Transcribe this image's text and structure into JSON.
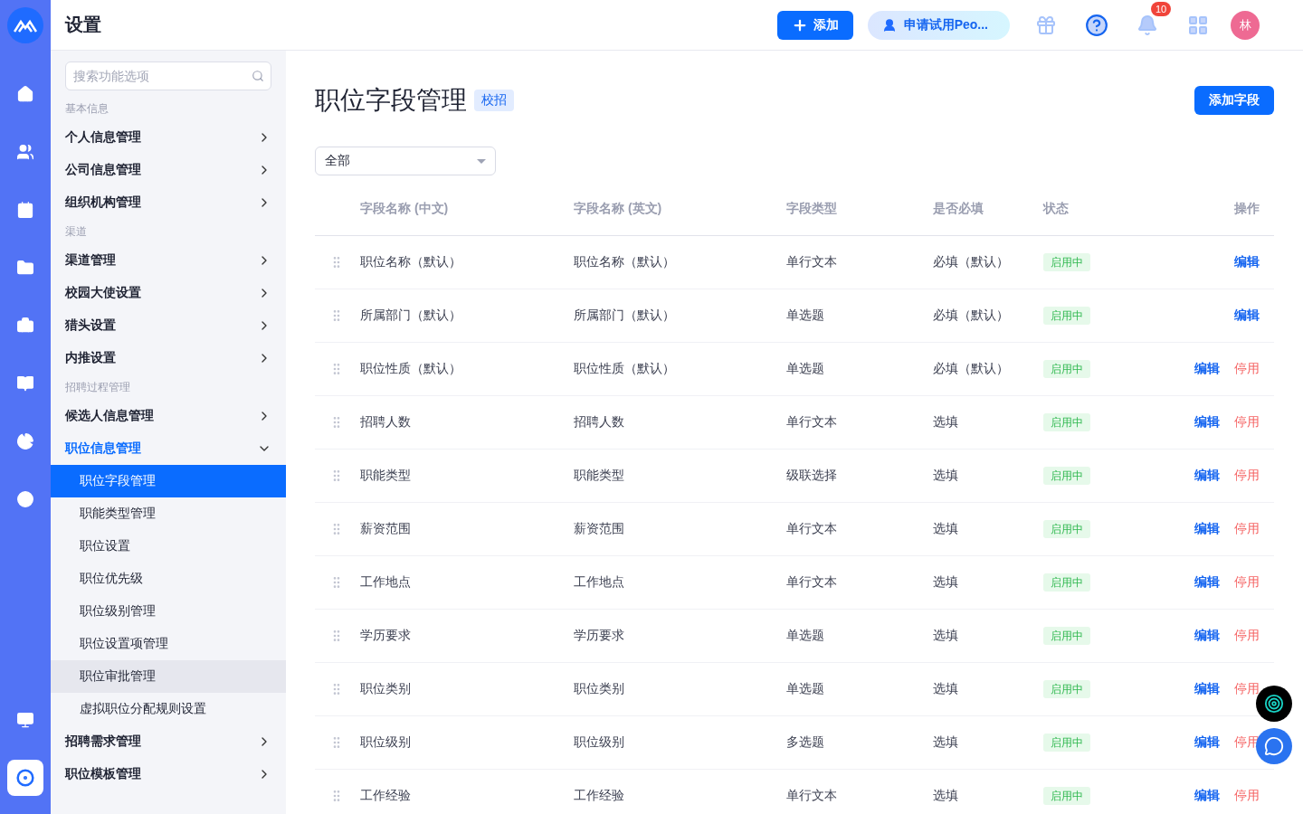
{
  "header": {
    "title": "设置",
    "add_button": "添加",
    "trial_button": "申请试用Peo...",
    "notification_count": "10",
    "avatar": "林"
  },
  "rail": [
    {
      "selected": false
    },
    {
      "selected": false
    },
    {
      "selected": false
    },
    {
      "selected": false
    },
    {
      "selected": false
    },
    {
      "selected": false
    },
    {
      "selected": false
    },
    {
      "selected": false
    }
  ],
  "rail_bottom": [
    {
      "selected": false
    },
    {
      "selected": true
    }
  ],
  "sidebar": {
    "search_placeholder": "搜索功能选项",
    "sections": [
      {
        "label": "基本信息",
        "items": [
          {
            "label": "个人信息管理",
            "expanded": false,
            "selected": false
          },
          {
            "label": "公司信息管理",
            "expanded": false,
            "selected": false
          },
          {
            "label": "组织机构管理",
            "expanded": false,
            "selected": false
          }
        ]
      },
      {
        "label": "渠道",
        "items": [
          {
            "label": "渠道管理",
            "expanded": false,
            "selected": false
          },
          {
            "label": "校园大使设置",
            "expanded": false,
            "selected": false
          },
          {
            "label": "猎头设置",
            "expanded": false,
            "selected": false
          },
          {
            "label": "内推设置",
            "expanded": false,
            "selected": false
          }
        ]
      },
      {
        "label": "招聘过程管理",
        "items": [
          {
            "label": "候选人信息管理",
            "expanded": false,
            "selected": false
          },
          {
            "label": "职位信息管理",
            "expanded": true,
            "selected": true,
            "children": [
              {
                "label": "职位字段管理",
                "selected": true,
                "highlighted": false
              },
              {
                "label": "职能类型管理",
                "selected": false,
                "highlighted": false
              },
              {
                "label": "职位设置",
                "selected": false,
                "highlighted": false
              },
              {
                "label": "职位优先级",
                "selected": false,
                "highlighted": false
              },
              {
                "label": "职位级别管理",
                "selected": false,
                "highlighted": false
              },
              {
                "label": "职位设置项管理",
                "selected": false,
                "highlighted": false
              },
              {
                "label": "职位审批管理",
                "selected": false,
                "highlighted": true
              },
              {
                "label": "虚拟职位分配规则设置",
                "selected": false,
                "highlighted": false
              }
            ]
          },
          {
            "label": "招聘需求管理",
            "expanded": false,
            "selected": false
          },
          {
            "label": "职位模板管理",
            "expanded": false,
            "selected": false
          }
        ]
      }
    ]
  },
  "page": {
    "title": "职位字段管理",
    "tag": "校招",
    "add_field_button": "添加字段",
    "filter": "全部"
  },
  "table": {
    "columns": [
      "字段名称 (中文)",
      "字段名称 (英文)",
      "字段类型",
      "是否必填",
      "状态",
      "操作"
    ],
    "rows": [
      {
        "name_cn": "职位名称（默认）",
        "name_en": "职位名称（默认）",
        "type": "单行文本",
        "required": "必填（默认）",
        "status": "启用中",
        "actions": [
          "编辑"
        ]
      },
      {
        "name_cn": "所属部门（默认）",
        "name_en": "所属部门（默认）",
        "type": "单选题",
        "required": "必填（默认）",
        "status": "启用中",
        "actions": [
          "编辑"
        ]
      },
      {
        "name_cn": "职位性质（默认）",
        "name_en": "职位性质（默认）",
        "type": "单选题",
        "required": "必填（默认）",
        "status": "启用中",
        "actions": [
          "编辑",
          "停用"
        ]
      },
      {
        "name_cn": "招聘人数",
        "name_en": "招聘人数",
        "type": "单行文本",
        "required": "选填",
        "status": "启用中",
        "actions": [
          "编辑",
          "停用"
        ]
      },
      {
        "name_cn": "职能类型",
        "name_en": "职能类型",
        "type": "级联选择",
        "required": "选填",
        "status": "启用中",
        "actions": [
          "编辑",
          "停用"
        ]
      },
      {
        "name_cn": "薪资范围",
        "name_en": "薪资范围",
        "type": "单行文本",
        "required": "选填",
        "status": "启用中",
        "actions": [
          "编辑",
          "停用"
        ]
      },
      {
        "name_cn": "工作地点",
        "name_en": "工作地点",
        "type": "单行文本",
        "required": "选填",
        "status": "启用中",
        "actions": [
          "编辑",
          "停用"
        ]
      },
      {
        "name_cn": "学历要求",
        "name_en": "学历要求",
        "type": "单选题",
        "required": "选填",
        "status": "启用中",
        "actions": [
          "编辑",
          "停用"
        ]
      },
      {
        "name_cn": "职位类别",
        "name_en": "职位类别",
        "type": "单选题",
        "required": "选填",
        "status": "启用中",
        "actions": [
          "编辑",
          "停用"
        ]
      },
      {
        "name_cn": "职位级别",
        "name_en": "职位级别",
        "type": "多选题",
        "required": "选填",
        "status": "启用中",
        "actions": [
          "编辑",
          "停用"
        ]
      },
      {
        "name_cn": "工作经验",
        "name_en": "工作经验",
        "type": "单行文本",
        "required": "选填",
        "status": "启用中",
        "actions": [
          "编辑",
          "停用"
        ]
      }
    ]
  }
}
